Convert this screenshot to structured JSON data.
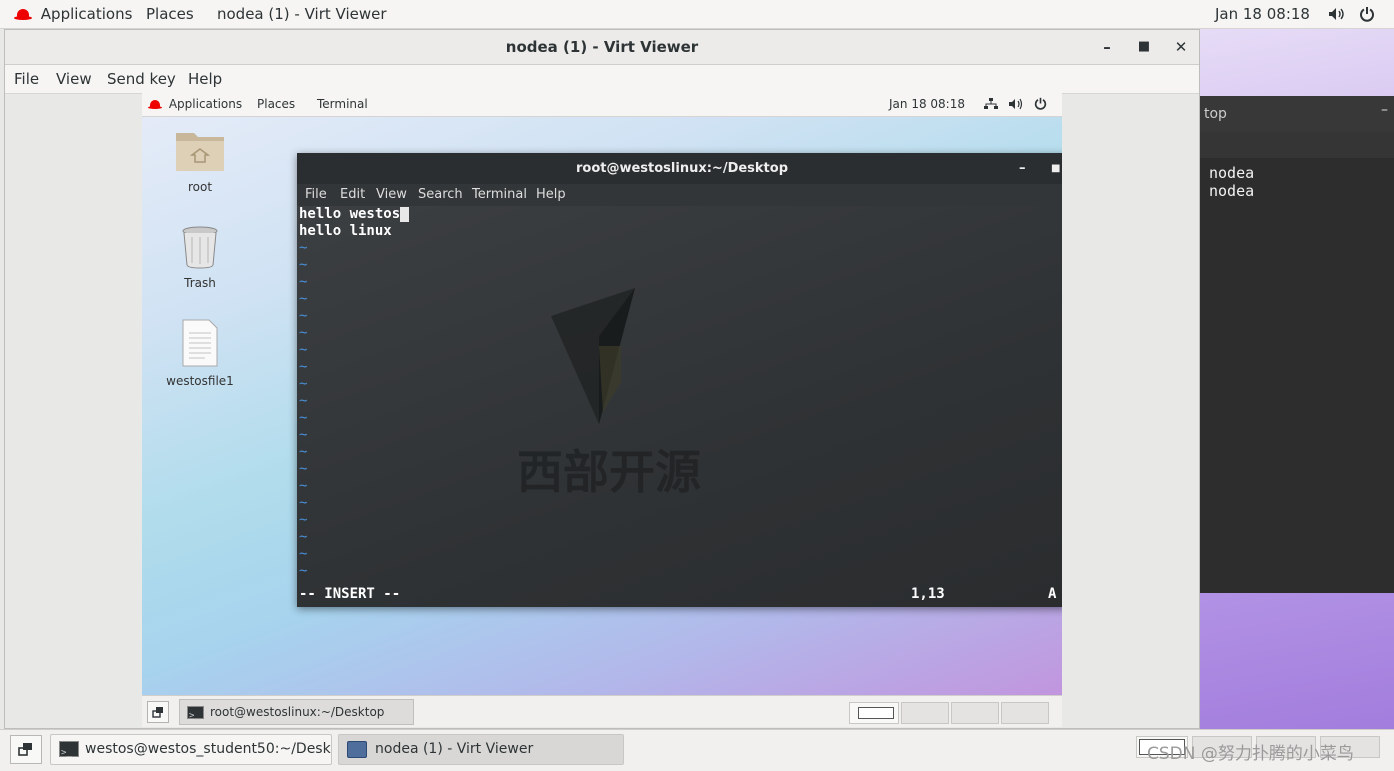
{
  "host_topbar": {
    "applications": "Applications",
    "places": "Places",
    "window_title": "nodea (1) - Virt Viewer",
    "datetime": "Jan 18  08:18"
  },
  "virt_viewer": {
    "title": "nodea (1) - Virt Viewer",
    "minimize": "–",
    "maximize": "□",
    "close": "✕",
    "menu": {
      "file": "File",
      "view": "View",
      "send_key": "Send key",
      "help": "Help"
    }
  },
  "guest": {
    "topbar": {
      "applications": "Applications",
      "places": "Places",
      "terminal": "Terminal",
      "datetime": "Jan 18  08:18"
    },
    "desktop_icons": {
      "root": "root",
      "trash": "Trash",
      "file": "westosfile1"
    },
    "terminal": {
      "title": "root@westoslinux:~/Desktop",
      "minimize": "–",
      "menu": {
        "file": "File",
        "edit": "Edit",
        "view": "View",
        "search": "Search",
        "terminal": "Terminal",
        "help": "Help"
      },
      "line1": "hello westos",
      "line2": "hello linux",
      "tilde": "~",
      "mode": "-- INSERT --",
      "position": "1,13",
      "scroll": "A"
    },
    "watermark": "西部开源",
    "taskbar": {
      "window_label": "root@westoslinux:~/Desktop"
    }
  },
  "host_bg_terminal": {
    "title_fragment": "top",
    "lines": [
      "nodea",
      "nodea"
    ]
  },
  "host_taskbar": {
    "task1": "westos@westos_student50:~/Desk...",
    "task2": "nodea (1) - Virt Viewer"
  },
  "overlay_watermark": "CSDN @努力扑腾的小菜鸟"
}
